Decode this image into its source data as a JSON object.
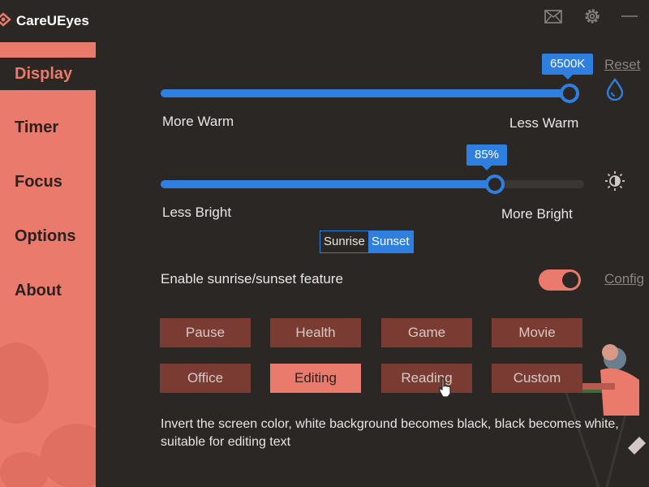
{
  "app": {
    "title": "CareUEyes",
    "icons": [
      "eye-logo-icon",
      "mail-icon",
      "gear-icon",
      "minimize-icon"
    ]
  },
  "sidebar": {
    "items": [
      {
        "label": "Display",
        "active": true
      },
      {
        "label": "Timer",
        "active": false
      },
      {
        "label": "Focus",
        "active": false
      },
      {
        "label": "Options",
        "active": false
      },
      {
        "label": "About",
        "active": false
      }
    ]
  },
  "colors": {
    "accent": "#2f7fe0",
    "brand": "#ea7a6b",
    "background": "#2b2725",
    "button": "#7a3b33"
  },
  "temperature": {
    "value_label": "6500K",
    "fraction": 1.0,
    "left_label": "More Warm",
    "right_label": "Less Warm",
    "reset_label": "Reset",
    "side_icon": "water-drop-icon"
  },
  "brightness": {
    "value_label": "85%",
    "fraction": 0.79,
    "left_label": "Less Bright",
    "right_label": "More Bright",
    "side_icon": "brightness-icon"
  },
  "sun_mode": {
    "options": [
      "Sunrise",
      "Sunset"
    ],
    "selected": "Sunset"
  },
  "sunrise_feature": {
    "label": "Enable sunrise/sunset feature",
    "enabled": true,
    "config_label": "Config"
  },
  "modes": {
    "row1": [
      "Pause",
      "Health",
      "Game",
      "Movie"
    ],
    "row2": [
      "Office",
      "Editing",
      "Reading",
      "Custom"
    ],
    "active": "Editing"
  },
  "description": "Invert the screen color, white background becomes black, black becomes white, suitable for editing text"
}
